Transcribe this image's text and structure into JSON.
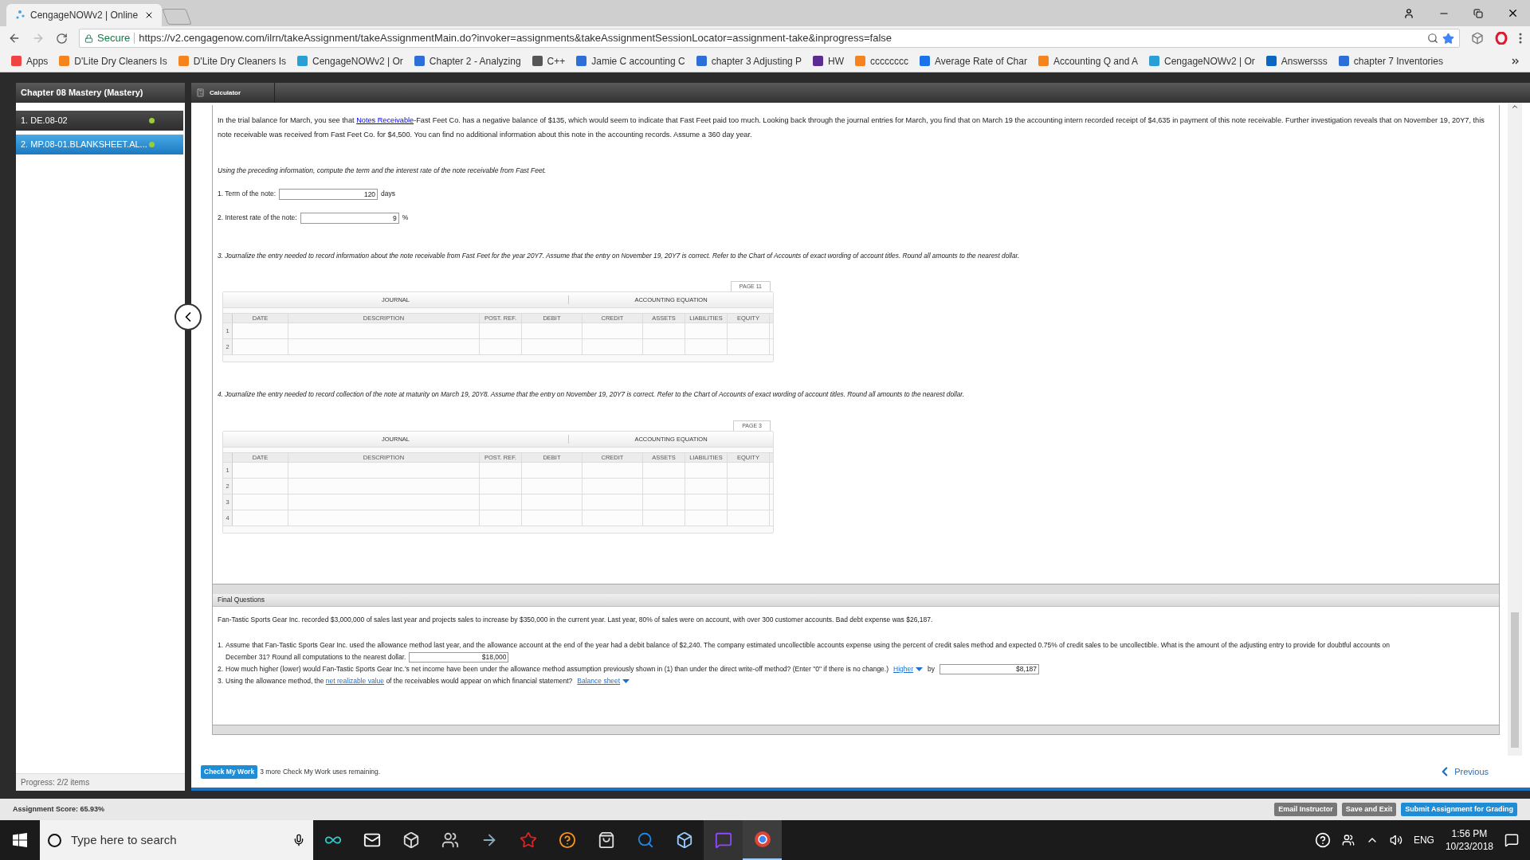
{
  "browser": {
    "tab_title": "CengageNOWv2 | Online",
    "secure_label": "Secure",
    "url": "https://v2.cengagenow.com/ilrn/takeAssignment/takeAssignmentMain.do?invoker=assignments&takeAssignmentSessionLocator=assignment-take&inprogress=false",
    "bookmarks": [
      {
        "label": "Apps"
      },
      {
        "label": "D'Lite Dry Cleaners Is"
      },
      {
        "label": "D'Lite Dry Cleaners Is"
      },
      {
        "label": "CengageNOWv2 | Or"
      },
      {
        "label": "Chapter 2 - Analyzing"
      },
      {
        "label": "C++"
      },
      {
        "label": "Jamie C accounting C"
      },
      {
        "label": "chapter 3 Adjusting P"
      },
      {
        "label": "HW"
      },
      {
        "label": "cccccccc"
      },
      {
        "label": "Average Rate of Char"
      },
      {
        "label": "Accounting Q and A"
      },
      {
        "label": "CengageNOWv2 | Or"
      },
      {
        "label": "Answersss"
      },
      {
        "label": "chapter 7 Inventories"
      }
    ]
  },
  "sidebar": {
    "title": "Chapter 08 Mastery (Mastery)",
    "items": [
      {
        "label": "1. DE.08-02",
        "selected": false
      },
      {
        "label": "2. MP.08-01.BLANKSHEET.AL...",
        "selected": true
      }
    ],
    "progress": "Progress:  2/2 items"
  },
  "toolbar": {
    "calculator": "Calculator"
  },
  "problem": {
    "intro": {
      "before": "In the trial balance for March, you see that ",
      "link": "Notes Receivable",
      "after": "-Fast Feet Co. has a negative balance of $135, which would seem to indicate that Fast Feet paid too much. Looking back through the journal entries for March, you find that on March 19 the accounting intern recorded receipt of $4,635 in payment of this note receivable. Further investigation reveals that on November 19, 20Y7, this note receivable was received from Fast Feet Co. for $4,500. You can find no additional information about this note in the accounting records. Assume a 360 day year."
    },
    "instruction": "Using the preceding information, compute the term and the interest rate of the note receivable from Fast Feet.",
    "fields": [
      {
        "label": "1. Term of the note:",
        "value": "120",
        "unit": "days"
      },
      {
        "label": "2. Interest rate of the note:",
        "value": "9",
        "unit": "%"
      }
    ],
    "journals": [
      {
        "instruction": "3. Journalize the entry needed to record information about the note receivable from Fast Feet for the year 20Y7. Assume that the entry on November 19, 20Y7 is correct. Refer to the Chart of Accounts of exact wording of account titles. Round all amounts to the nearest dollar.",
        "page": "PAGE 11",
        "journal_heading": "JOURNAL",
        "equation_heading": "ACCOUNTING EQUATION",
        "columns": [
          "DATE",
          "DESCRIPTION",
          "POST. REF.",
          "DEBIT",
          "CREDIT",
          "ASSETS",
          "LIABILITIES",
          "EQUITY"
        ],
        "rows": [
          "1",
          "2"
        ]
      },
      {
        "instruction": "4. Journalize the entry needed to record collection of the note at maturity on March 19, 20Y8. Assume that the entry on November 19, 20Y7 is correct. Refer to the Chart of Accounts of exact wording of account titles. Round all amounts to the nearest dollar.",
        "page": "PAGE 3",
        "journal_heading": "JOURNAL",
        "equation_heading": "ACCOUNTING EQUATION",
        "columns": [
          "DATE",
          "DESCRIPTION",
          "POST. REF.",
          "DEBIT",
          "CREDIT",
          "ASSETS",
          "LIABILITIES",
          "EQUITY"
        ],
        "rows": [
          "1",
          "2",
          "3",
          "4"
        ]
      }
    ]
  },
  "final_questions": {
    "title": "Final Questions",
    "intro": "Fan-Tastic Sports Gear Inc. recorded $3,000,000 of sales last year and projects sales to increase by $350,000 in the current year. Last year, 80% of sales were on account, with over 300 customer accounts. Bad debt expense was $26,187.",
    "q1": {
      "num": "1.",
      "text": "Assume that Fan-Tastic Sports Gear Inc. used the allowance method last year, and the allowance account at the end of the year had a debit balance of $2,240. The company estimated uncollectible accounts expense using the percent of credit sales method and expected 0.75% of credit sales to be uncollectible. What is the amount of the adjusting entry to provide for doubtful accounts on",
      "text_cont": "December 31? Round all computations to the nearest dollar.",
      "answer": "$18,000"
    },
    "q2": {
      "num": "2.",
      "text": "How much higher (lower) would Fan-Tastic Sports Gear Inc.'s net income have been under the allowance method assumption previously shown in (1) than under the direct write-off method? (Enter \"0\" if there is no change.)",
      "choice": "Higher",
      "by": "by",
      "answer": "$8,187"
    },
    "q3": {
      "num": "3.",
      "before": "Using the allowance method, the ",
      "link": "net realizable value",
      "after": " of the receivables would appear on which financial statement?",
      "choice": "Balance sheet"
    }
  },
  "footer": {
    "check_button": "Check My Work",
    "remaining": "3 more Check My Work uses remaining.",
    "previous": "Previous",
    "score": "Assignment Score: 65.93%",
    "buttons": [
      "Email Instructor",
      "Save and Exit",
      "Submit Assignment for Grading"
    ]
  },
  "taskbar": {
    "search_placeholder": "Type here to search",
    "language": "ENG",
    "time": "1:56 PM",
    "date": "10/23/2018"
  }
}
